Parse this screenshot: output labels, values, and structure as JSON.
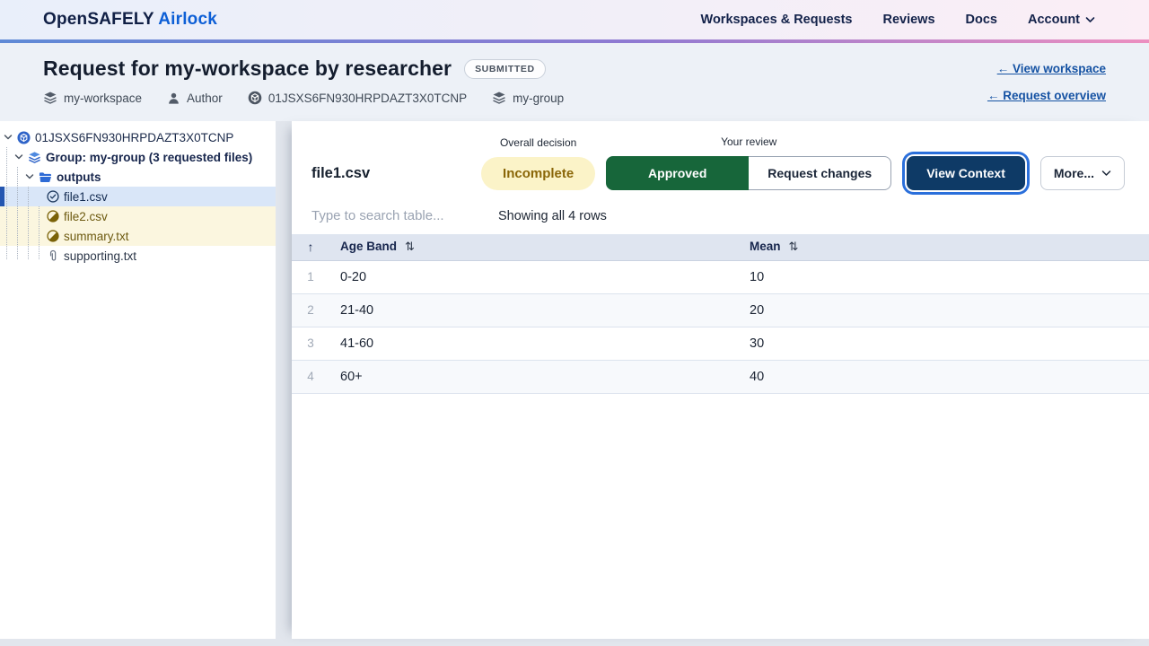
{
  "colors": {
    "brand_navy": "#101f45",
    "brand_blue": "#0d5fd6",
    "gradient_bar": [
      "#5f8ad6",
      "#8f7ad2",
      "#ec8fc0"
    ],
    "approved_green": "#17663a",
    "view_context_navy": "#0e3a66",
    "focus_ring_blue": "#2a6fdb",
    "incomplete_bg": "#fbf3c8",
    "incomplete_text": "#8a6608",
    "selected_row_bg": "#d9e6f8",
    "selected_row_bar": "#2456b0",
    "pending_row_bg": "#fbf6df",
    "pending_text": "#6d5a10",
    "table_header_bg": "#dfe5f0"
  },
  "nav": {
    "brand_primary": "OpenSAFELY",
    "brand_accent": "Airlock",
    "items": [
      "Workspaces & Requests",
      "Reviews",
      "Docs",
      "Account"
    ]
  },
  "header": {
    "title": "Request for my-workspace by researcher",
    "status": "SUBMITTED",
    "meta": [
      {
        "icon": "layers-icon",
        "label": "my-workspace"
      },
      {
        "icon": "user-icon",
        "label": "Author"
      },
      {
        "icon": "cube-icon",
        "label": "01JSXS6FN930HRPDAZT3X0TCNP"
      },
      {
        "icon": "layers-icon",
        "label": "my-group"
      }
    ],
    "links": [
      "← View workspace",
      "← Request overview"
    ]
  },
  "sidebar": {
    "tree": [
      {
        "label": "01JSXS6FN930HRPDAZT3X0TCNP",
        "type": "request-root"
      },
      {
        "label": "Group: my-group (3 requested files)",
        "type": "group"
      },
      {
        "label": "outputs",
        "type": "folder"
      },
      {
        "label": "file1.csv",
        "type": "file",
        "state": "approved",
        "selected": true
      },
      {
        "label": "file2.csv",
        "type": "file",
        "state": "pending"
      },
      {
        "label": "summary.txt",
        "type": "file",
        "state": "pending"
      },
      {
        "label": "supporting.txt",
        "type": "file",
        "state": "attachment"
      }
    ]
  },
  "main": {
    "filename": "file1.csv",
    "overall_decision": {
      "label": "Overall decision",
      "value": "Incomplete"
    },
    "your_review": {
      "label": "Your review",
      "approve": "Approved",
      "request_changes": "Request changes"
    },
    "view_context": "View Context",
    "more": "More...",
    "toolbar": {
      "search_placeholder": "Type to search table...",
      "row_count": "Showing all 4 rows"
    },
    "table": {
      "sort_all_glyph": "↑",
      "sort_glyph": "⇅",
      "columns": [
        "Age Band",
        "Mean"
      ],
      "rows": [
        {
          "num": "1",
          "age_band": "0-20",
          "mean": "10"
        },
        {
          "num": "2",
          "age_band": "21-40",
          "mean": "20"
        },
        {
          "num": "3",
          "age_band": "41-60",
          "mean": "30"
        },
        {
          "num": "4",
          "age_band": "60+",
          "mean": "40"
        }
      ]
    }
  }
}
